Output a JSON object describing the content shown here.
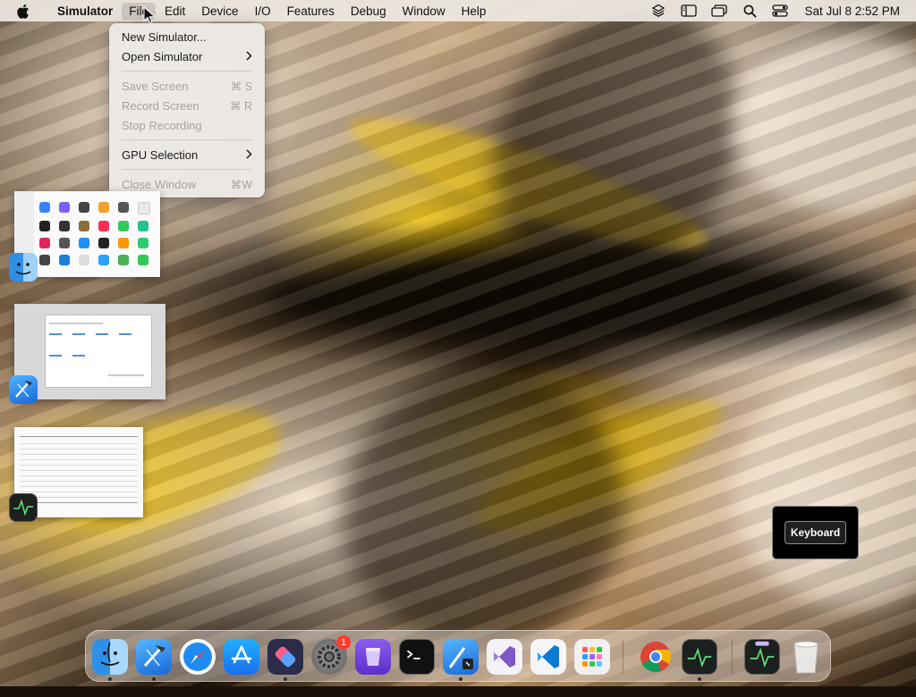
{
  "menubar": {
    "app_name": "Simulator",
    "menus": [
      "File",
      "Edit",
      "Device",
      "I/O",
      "Features",
      "Debug",
      "Window",
      "Help"
    ],
    "clock": "Sat Jul 8  2:52 PM",
    "status_icons": [
      "layers-icon",
      "sidebar-icon",
      "windows-icon",
      "spotlight-search-icon",
      "control-center-icon"
    ]
  },
  "file_menu": {
    "items": [
      {
        "label": "New Simulator...",
        "shortcut": "",
        "enabled": true
      },
      {
        "label": "Open Simulator",
        "shortcut": "",
        "enabled": true,
        "submenu": true
      },
      {
        "label": "Save Screen",
        "shortcut": "⌘ S",
        "enabled": false
      },
      {
        "label": "Record Screen",
        "shortcut": "⌘ R",
        "enabled": false
      },
      {
        "label": "Stop Recording",
        "shortcut": "",
        "enabled": false
      },
      {
        "label": "GPU Selection",
        "shortcut": "",
        "enabled": true,
        "submenu": true
      },
      {
        "label": "Close Window",
        "shortcut": "⌘W",
        "enabled": false
      }
    ]
  },
  "keyboard_hud": {
    "label": "Keyboard"
  },
  "dock": {
    "apps": [
      "finder",
      "xcode",
      "safari",
      "app-store",
      "shortcuts",
      "system-settings",
      "apple-configurator",
      "terminal",
      "xcode-beta",
      "visual-studio",
      "vscode",
      "launchpad",
      "chrome",
      "activity-monitor",
      "activity-monitor-2",
      "trash"
    ],
    "system_settings_badge": "1"
  },
  "colors": {
    "menu_bg": "#eee8e2",
    "dock_bg": "#ebe1d7",
    "badge": "#ff3b30"
  }
}
